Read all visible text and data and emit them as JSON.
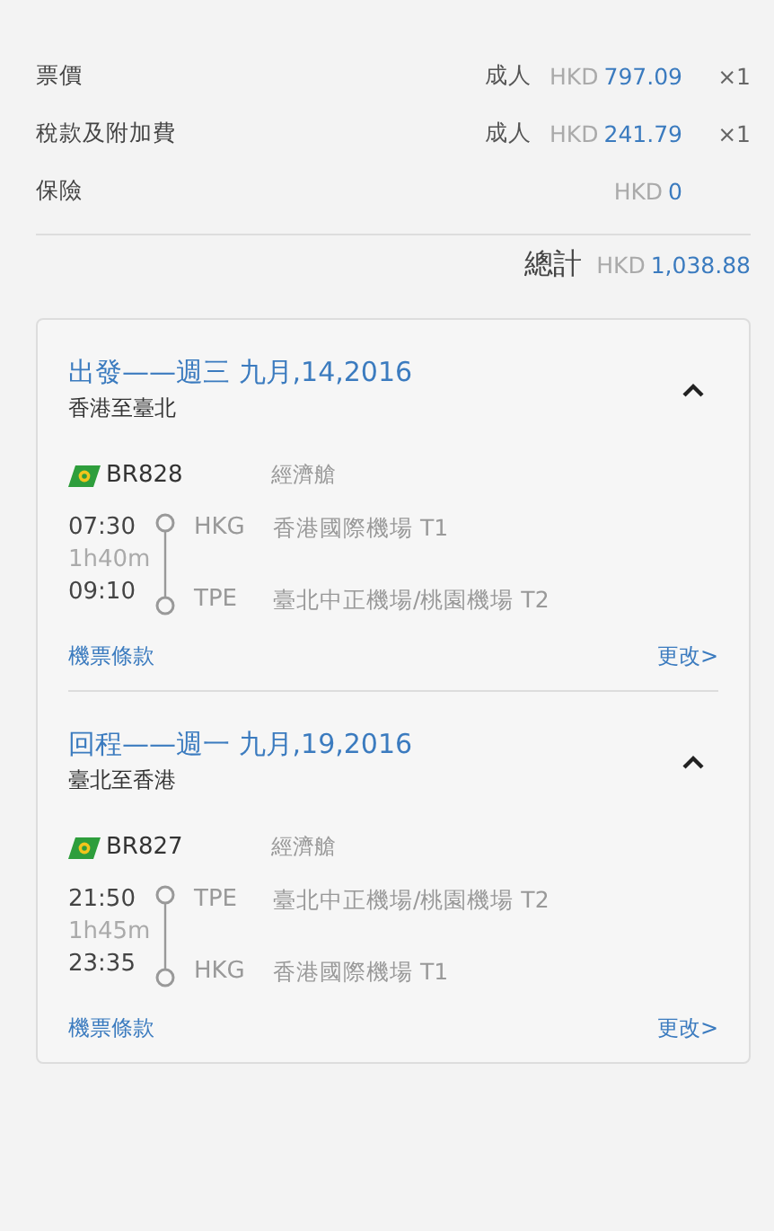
{
  "fare_rows": [
    {
      "label": "票價",
      "passenger": "成人",
      "currency": "HKD",
      "amount": "797.09",
      "count": "×1"
    },
    {
      "label": "稅款及附加費",
      "passenger": "成人",
      "currency": "HKD",
      "amount": "241.79",
      "count": "×1"
    },
    {
      "label": "保險",
      "currency": "HKD",
      "amount": "0"
    }
  ],
  "total": {
    "label": "總計",
    "currency": "HKD",
    "amount": "1,038.88"
  },
  "segments": [
    {
      "title": "出發——週三 九月,14,2016",
      "route": "香港至臺北",
      "expanded": true,
      "flight": "BR828",
      "cabin": "經濟艙",
      "depart_time": "07:30",
      "duration": "1h40m",
      "arrive_time": "09:10",
      "depart_code": "HKG",
      "depart_airport": "香港國際機場 T1",
      "arrive_code": "TPE",
      "arrive_airport": "臺北中正機場/桃園機場 T2",
      "rules_link": "機票條款",
      "change_link": "更改>"
    },
    {
      "title": "回程——週一 九月,19,2016",
      "route": "臺北至香港",
      "expanded": true,
      "flight": "BR827",
      "cabin": "經濟艙",
      "depart_time": "21:50",
      "duration": "1h45m",
      "arrive_time": "23:35",
      "depart_code": "TPE",
      "depart_airport": "臺北中正機場/桃園機場 T2",
      "arrive_code": "HKG",
      "arrive_airport": "香港國際機場 T1",
      "rules_link": "機票條款",
      "change_link": "更改>"
    }
  ]
}
